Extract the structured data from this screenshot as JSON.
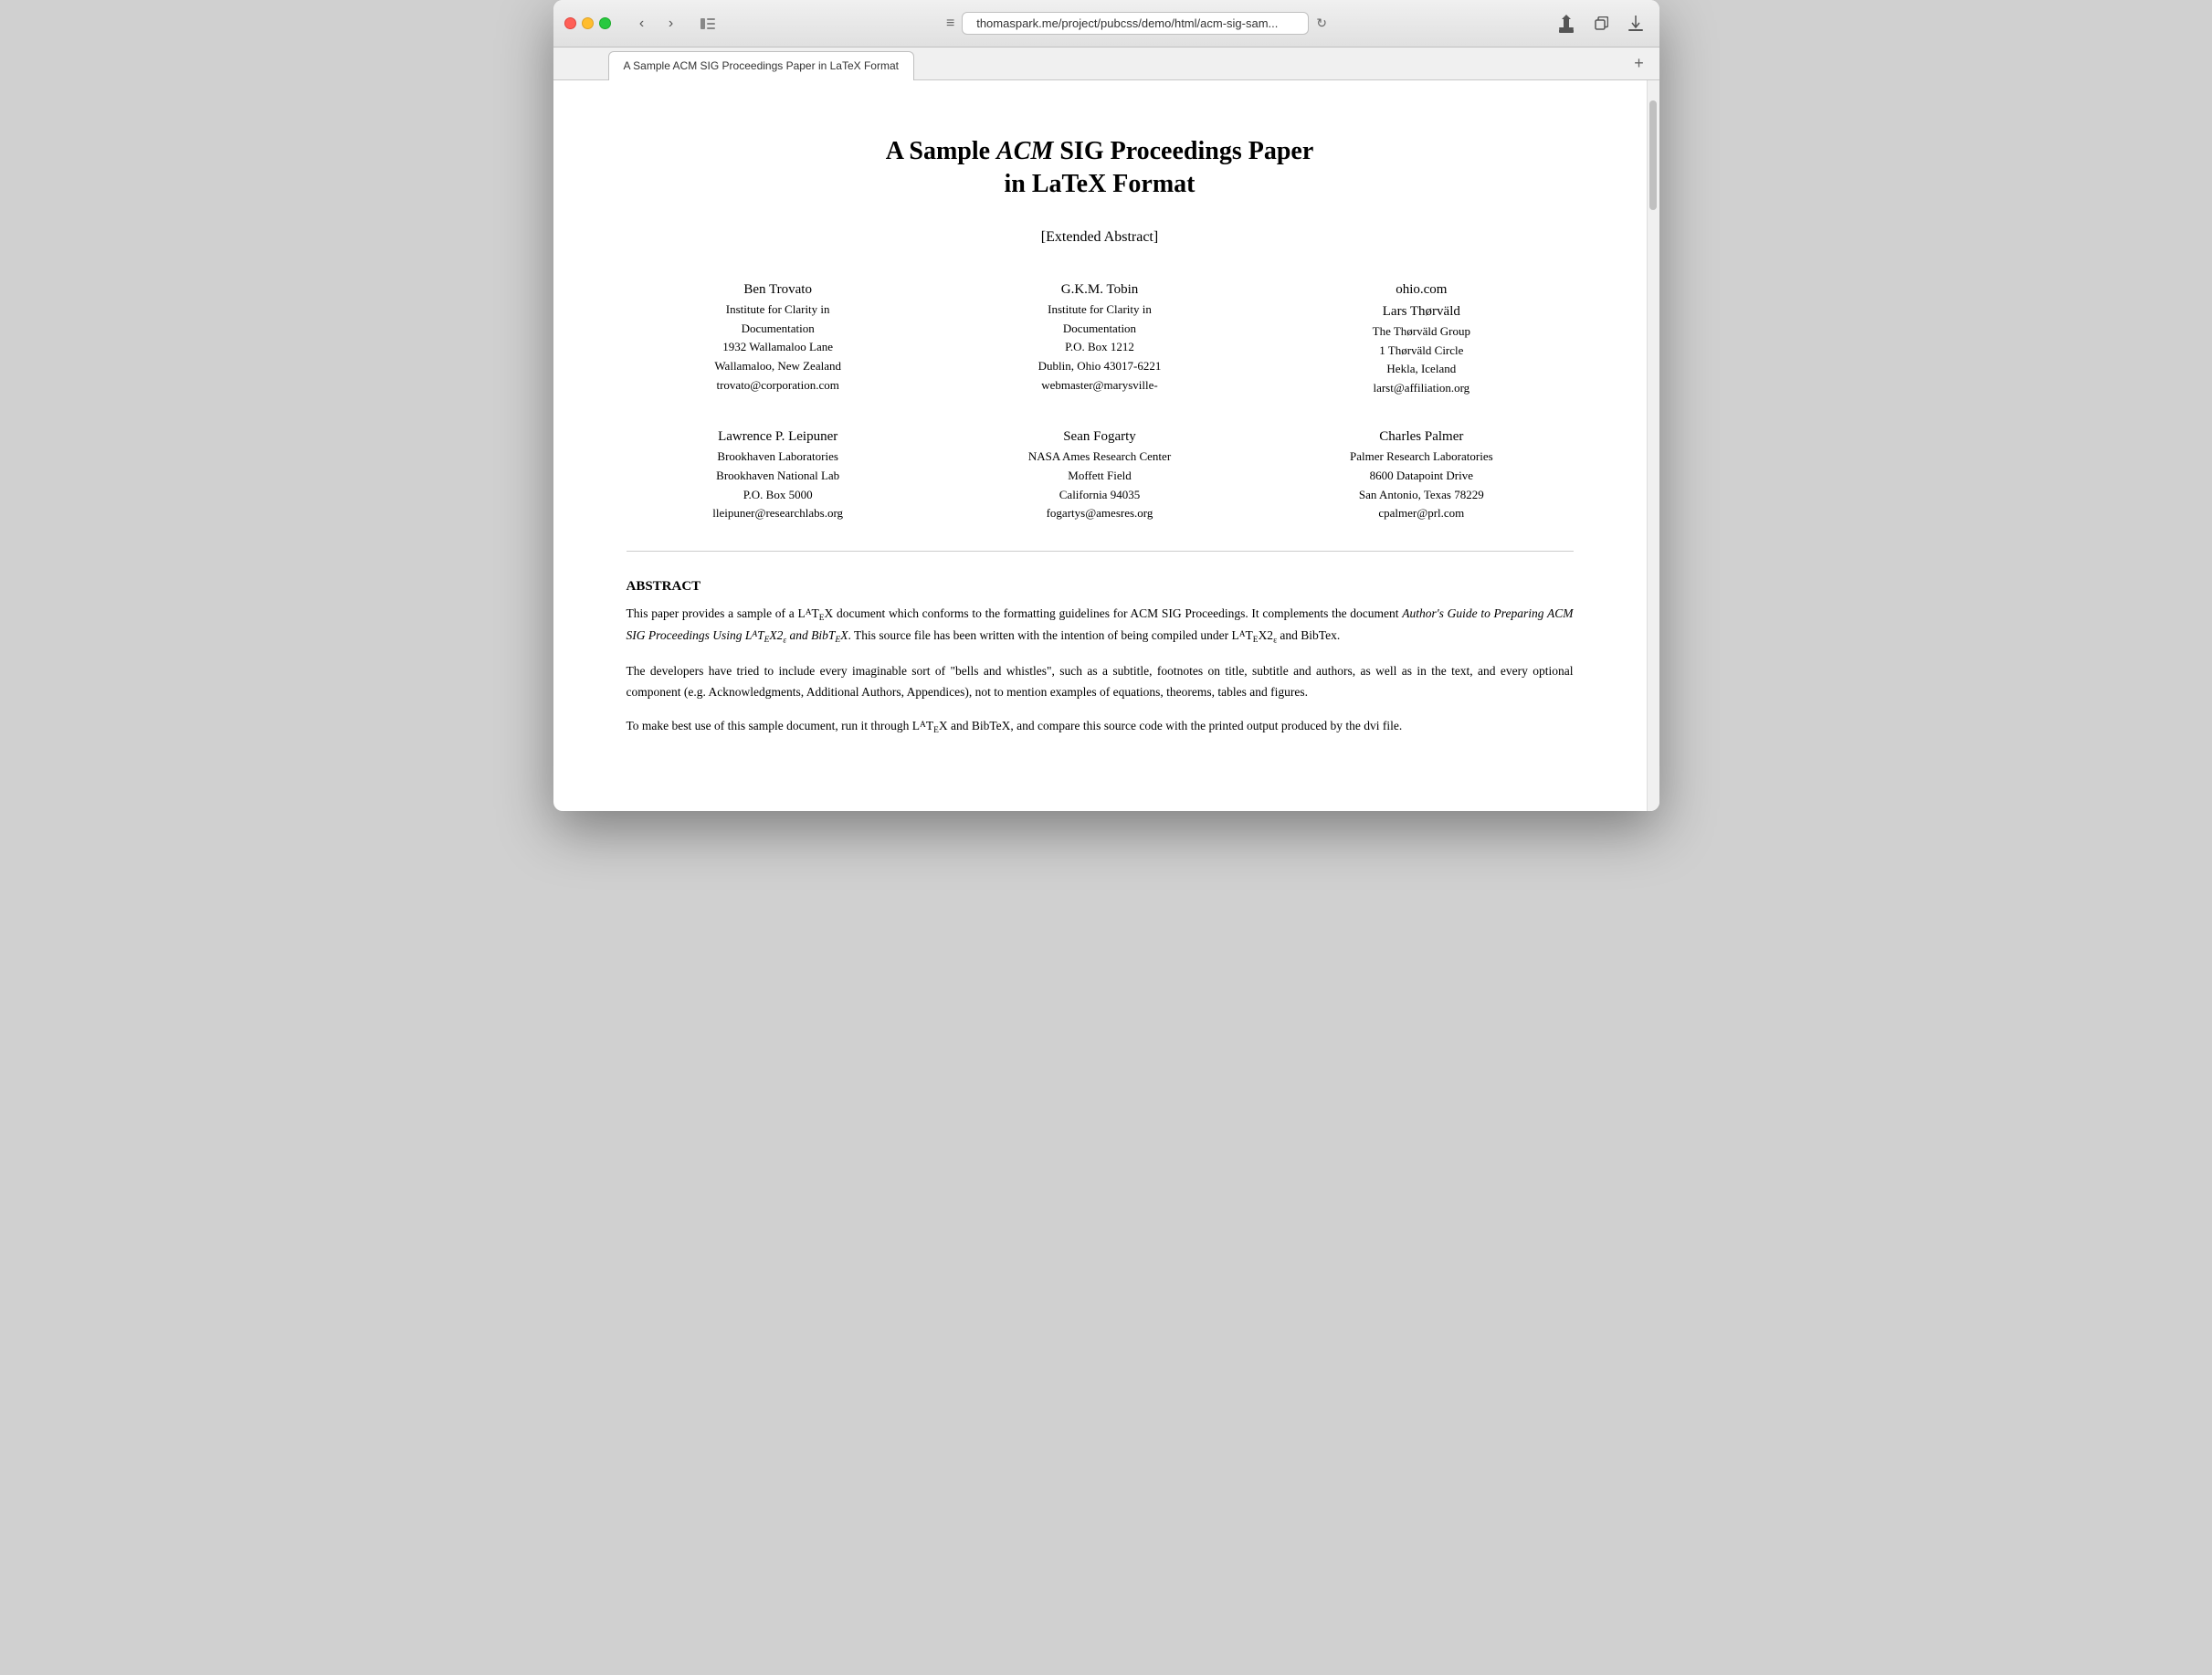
{
  "browser": {
    "title": "A Sample ACM SIG Proceedings Paper in LaTeX Format",
    "url": "thomaspark.me/project/pubcss/demo/html/acm-sig-sam...",
    "tab_label": "A Sample ACM SIG Proceedings Paper in LaTeX Format",
    "back_btn": "‹",
    "forward_btn": "›",
    "menu_icon": "≡",
    "reload_icon": "↻",
    "share_icon": "⬆",
    "duplicate_icon": "⧉",
    "download_icon": "⬇",
    "add_tab_icon": "+"
  },
  "paper": {
    "title_part1": "A Sample ",
    "title_acm": "ACM",
    "title_part2": " SIG Proceedings Paper",
    "title_line2": "in LaTeX Format",
    "subtitle": "[Extended Abstract]",
    "authors": [
      {
        "name": "Ben Trovato",
        "line1": "Institute for Clarity in",
        "line2": "Documentation",
        "line3": "1932 Wallamaloo Lane",
        "line4": "Wallamaloo, New Zealand",
        "email": "trovato@corporation.com"
      },
      {
        "name": "G.K.M. Tobin",
        "line1": "Institute for Clarity in",
        "line2": "Documentation",
        "line3": "P.O. Box 1212",
        "line4": "Dublin, Ohio 43017-6221",
        "email": "webmaster@marysville-"
      },
      {
        "name": "ohio.com",
        "name2": "Lars Thørväld",
        "line1": "The Thørväld Group",
        "line2": "1 Thørväld Circle",
        "line3": "Hekla, Iceland",
        "email": "larst@affiliation.org"
      }
    ],
    "authors2": [
      {
        "name": "Lawrence P. Leipuner",
        "line1": "Brookhaven Laboratories",
        "line2": "Brookhaven National Lab",
        "line3": "P.O. Box 5000",
        "email": "lleipuner@researchlabs.org"
      },
      {
        "name": "Sean Fogarty",
        "line1": "NASA Ames Research Center",
        "line2": "Moffett Field",
        "line3": "California 94035",
        "email": "fogartys@amesres.org"
      },
      {
        "name": "Charles Palmer",
        "line1": "Palmer Research Laboratories",
        "line2": "8600 Datapoint Drive",
        "line3": "San Antonio, Texas 78229",
        "email": "cpalmer@prl.com"
      }
    ],
    "abstract_title": "ABSTRACT",
    "abstract_p1": "This paper provides a sample of a LATEX document which conforms to the formatting guidelines for ACM SIG Proceedings. It complements the document Author's Guide to Preparing ACM SIG Proceedings Using LATEX2ε and BibTEX. This source file has been written with the intention of being compiled under LATEX2ε and BibTex.",
    "abstract_p2": "The developers have tried to include every imaginable sort of \"bells and whistles\", such as a subtitle, footnotes on title, subtitle and authors, as well as in the text, and every optional component (e.g. Acknowledgments, Additional Authors, Appendices), not to mention examples of equations, theorems, tables and figures.",
    "abstract_p3": "To make best use of this sample document, run it through LATEX and BibTeX, and compare this source code with the printed output produced by the dvi file."
  }
}
